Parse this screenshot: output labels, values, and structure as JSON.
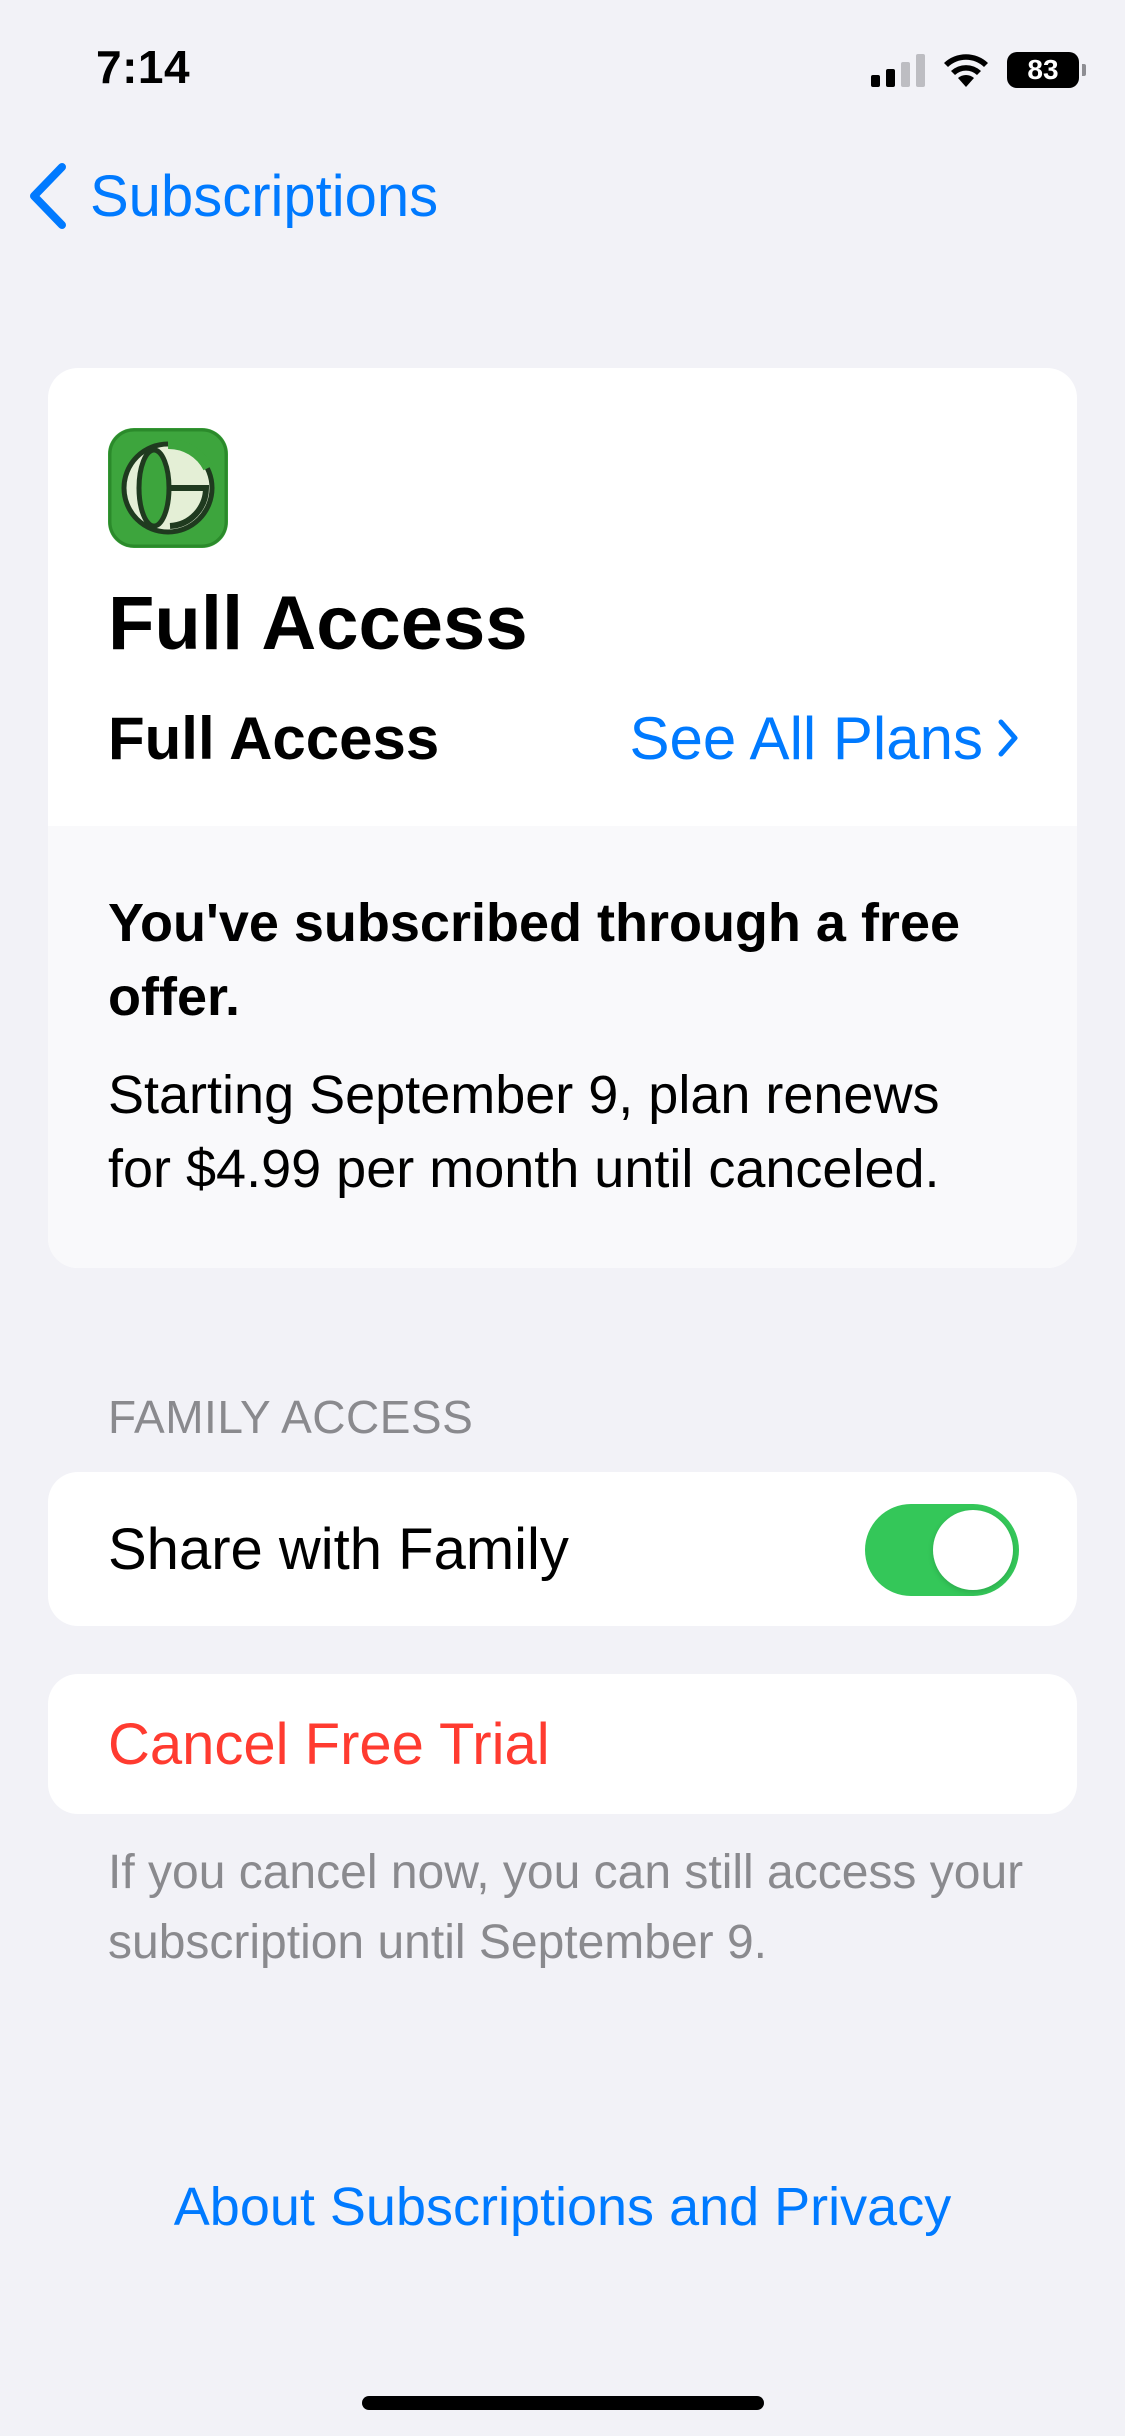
{
  "status_bar": {
    "time": "7:14",
    "battery": "83",
    "icons": [
      "cellular-signal-icon",
      "wifi-icon",
      "battery-icon"
    ]
  },
  "nav": {
    "back_label": "Subscriptions"
  },
  "plan_card": {
    "app_icon": "app-logo-icon",
    "title": "Full Access",
    "plan_name": "Full Access",
    "see_all_label": "See All Plans",
    "offer_title": "You've subscribed through a free offer.",
    "offer_text": "Starting September 9, plan renews for $4.99 per month until canceled."
  },
  "family_section": {
    "header": "FAMILY ACCESS",
    "share_label": "Share with Family",
    "share_enabled": true
  },
  "cancel": {
    "label": "Cancel Free Trial",
    "footnote": "If you cancel now, you can still access your subscription until September 9."
  },
  "footer": {
    "about_label": "About Subscriptions and Privacy"
  },
  "colors": {
    "accent": "#007AFF",
    "destructive": "#FF3B30",
    "toggle_on": "#34C759",
    "background": "#F2F2F7",
    "app_icon_green": "#3DA53D"
  }
}
